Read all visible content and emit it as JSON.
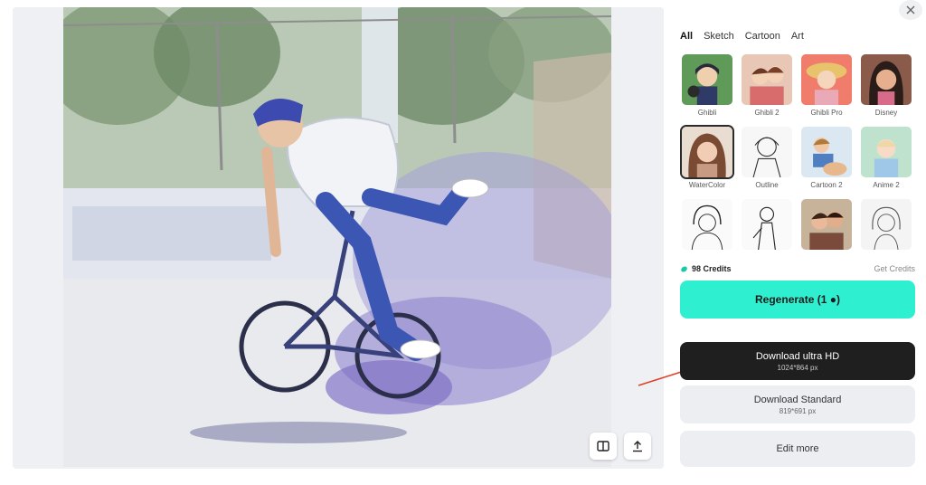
{
  "tabs": [
    "All",
    "Sketch",
    "Cartoon",
    "Art"
  ],
  "styles": [
    {
      "label": "Ghibli",
      "selected": false
    },
    {
      "label": "Ghibli 2",
      "selected": false
    },
    {
      "label": "Ghibli Pro",
      "selected": false
    },
    {
      "label": "Disney",
      "selected": false
    },
    {
      "label": "WaterColor",
      "selected": true
    },
    {
      "label": "Outline",
      "selected": false
    },
    {
      "label": "Cartoon 2",
      "selected": false
    },
    {
      "label": "Anime 2",
      "selected": false
    },
    {
      "label": "",
      "selected": false
    },
    {
      "label": "",
      "selected": false
    },
    {
      "label": "",
      "selected": false
    },
    {
      "label": "",
      "selected": false
    }
  ],
  "credits": {
    "amount": "98 Credits",
    "get_label": "Get Credits"
  },
  "regenerate": {
    "label": "Regenerate (1 ●)"
  },
  "download_ultra": {
    "title": "Download ultra HD",
    "size": "1024*864 px"
  },
  "download_standard": {
    "title": "Download Standard",
    "size": "819*691 px"
  },
  "edit_more": {
    "label": "Edit more"
  },
  "colors": {
    "accent": "#2ef0d0",
    "dark_button": "#1f1f1f",
    "arrow": "#e0402a"
  }
}
